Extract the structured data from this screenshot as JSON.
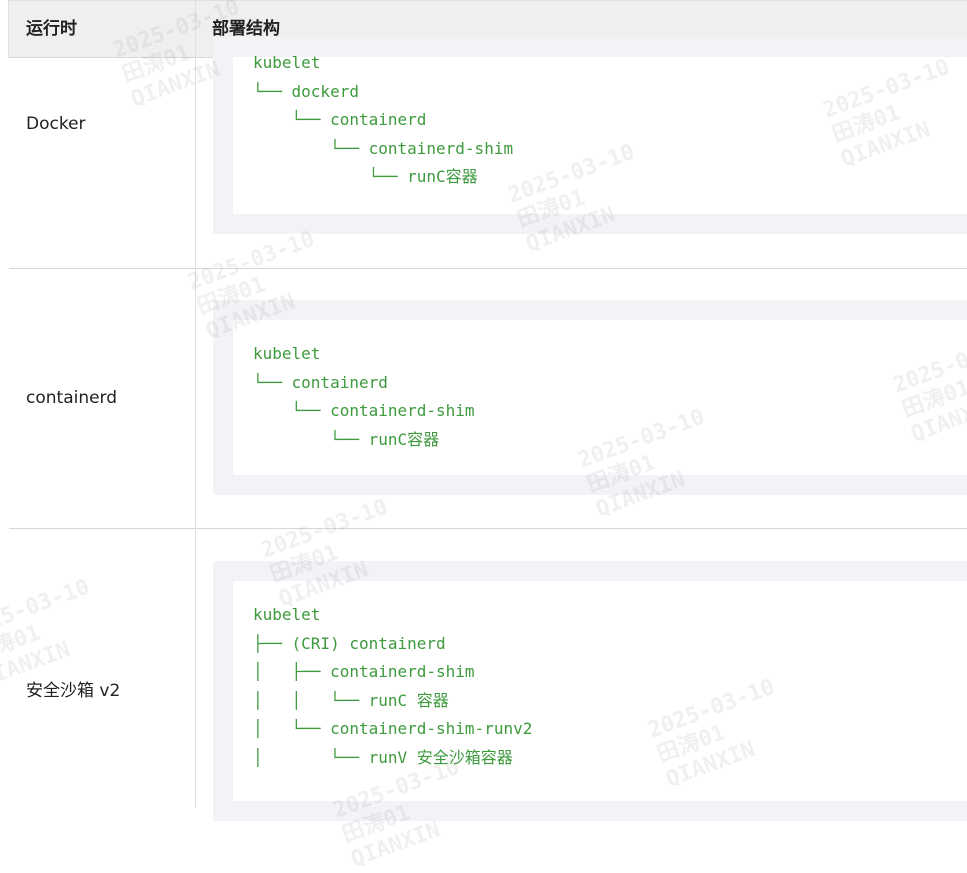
{
  "table": {
    "headers": [
      "运行时",
      "部署结构"
    ],
    "rows": [
      {
        "runtime": "Docker",
        "structure": [
          "kubelet",
          "└── dockerd",
          "    └── containerd",
          "        └── containerd-shim",
          "            └── runC容器"
        ]
      },
      {
        "runtime": "containerd",
        "structure": [
          "kubelet",
          "└── containerd",
          "    └── containerd-shim",
          "        └── runC容器"
        ]
      },
      {
        "runtime": "安全沙箱 v2",
        "structure": [
          "kubelet",
          "├── (CRI) containerd",
          "│   ├── containerd-shim",
          "│   │   └── runC 容器",
          "│   └── containerd-shim-runv2",
          "│       └── runV 安全沙箱容器"
        ]
      }
    ]
  },
  "watermark": {
    "date": "2025-03-10",
    "name": "田涛01",
    "org": "QIANXIN"
  },
  "colors": {
    "code_text": "#3d9a3d",
    "header_bg": "#efefef",
    "code_bg": "#f2f3f7"
  }
}
